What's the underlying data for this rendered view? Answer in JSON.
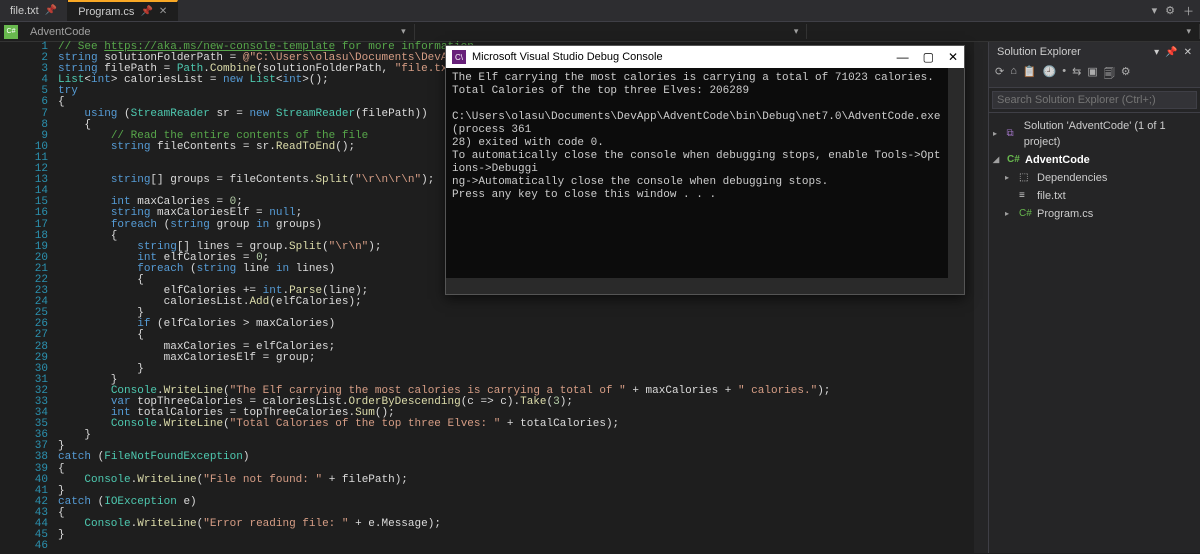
{
  "tabs": {
    "inactive": {
      "label": "file.txt",
      "pin_icon": "📌"
    },
    "active": {
      "label": "Program.cs",
      "pin_icon": "📌",
      "close_icon": "✕"
    },
    "right_icons": {
      "dropdown": "▾",
      "gear": "⚙",
      "add": "＋"
    }
  },
  "breadcrumb": {
    "project_icon": "C#",
    "project": "AdventCode",
    "chev": "▾"
  },
  "code_lines": [
    {
      "n": 1,
      "seg": [
        {
          "c": "cm",
          "t": "// See "
        },
        {
          "c": "url",
          "t": "https://aka.ms/new-console-template"
        },
        {
          "c": "cm",
          "t": " for more information"
        }
      ]
    },
    {
      "n": 2,
      "seg": [
        {
          "c": "kw",
          "t": "string"
        },
        {
          "c": "punct",
          "t": " solutionFolderPath = "
        },
        {
          "c": "str",
          "t": "@\"C:\\Users\\olasu\\Documents\\DevApp\\AdventCode\""
        },
        {
          "c": "punct",
          "t": ";"
        }
      ]
    },
    {
      "n": 3,
      "seg": [
        {
          "c": "kw",
          "t": "string"
        },
        {
          "c": "punct",
          "t": " filePath = "
        },
        {
          "c": "type",
          "t": "Path"
        },
        {
          "c": "punct",
          "t": "."
        },
        {
          "c": "mtd",
          "t": "Combine"
        },
        {
          "c": "punct",
          "t": "(solutionFolderPath, "
        },
        {
          "c": "str",
          "t": "\"file.txt\""
        },
        {
          "c": "punct",
          "t": ");"
        }
      ]
    },
    {
      "n": 4,
      "seg": [
        {
          "c": "type",
          "t": "List"
        },
        {
          "c": "punct",
          "t": "<"
        },
        {
          "c": "kw",
          "t": "int"
        },
        {
          "c": "punct",
          "t": "> caloriesList = "
        },
        {
          "c": "kw",
          "t": "new"
        },
        {
          "c": "punct",
          "t": " "
        },
        {
          "c": "type",
          "t": "List"
        },
        {
          "c": "punct",
          "t": "<"
        },
        {
          "c": "kw",
          "t": "int"
        },
        {
          "c": "punct",
          "t": ">();"
        }
      ]
    },
    {
      "n": 5,
      "seg": [
        {
          "c": "kw",
          "t": "try"
        }
      ]
    },
    {
      "n": 6,
      "seg": [
        {
          "c": "punct",
          "t": "{"
        }
      ]
    },
    {
      "n": 7,
      "seg": [
        {
          "c": "punct",
          "t": "    "
        },
        {
          "c": "kw",
          "t": "using"
        },
        {
          "c": "punct",
          "t": " ("
        },
        {
          "c": "type",
          "t": "StreamReader"
        },
        {
          "c": "punct",
          "t": " sr = "
        },
        {
          "c": "kw",
          "t": "new"
        },
        {
          "c": "punct",
          "t": " "
        },
        {
          "c": "type",
          "t": "StreamReader"
        },
        {
          "c": "punct",
          "t": "(filePath))"
        }
      ]
    },
    {
      "n": 8,
      "seg": [
        {
          "c": "punct",
          "t": "    {"
        }
      ]
    },
    {
      "n": 9,
      "seg": [
        {
          "c": "punct",
          "t": "        "
        },
        {
          "c": "cm",
          "t": "// Read the entire contents of the file"
        }
      ]
    },
    {
      "n": 10,
      "seg": [
        {
          "c": "punct",
          "t": "        "
        },
        {
          "c": "kw",
          "t": "string"
        },
        {
          "c": "punct",
          "t": " fileContents = sr."
        },
        {
          "c": "mtd",
          "t": "ReadToEnd"
        },
        {
          "c": "punct",
          "t": "();"
        }
      ]
    },
    {
      "n": 11,
      "seg": [
        {
          "c": "punct",
          "t": ""
        }
      ]
    },
    {
      "n": 12,
      "seg": [
        {
          "c": "punct",
          "t": ""
        }
      ]
    },
    {
      "n": 13,
      "seg": [
        {
          "c": "punct",
          "t": "        "
        },
        {
          "c": "kw",
          "t": "string"
        },
        {
          "c": "punct",
          "t": "[] groups = fileContents."
        },
        {
          "c": "mtd",
          "t": "Split"
        },
        {
          "c": "punct",
          "t": "("
        },
        {
          "c": "str",
          "t": "\"\\r\\n\\r\\n\""
        },
        {
          "c": "punct",
          "t": ");"
        }
      ]
    },
    {
      "n": 14,
      "seg": [
        {
          "c": "punct",
          "t": ""
        }
      ]
    },
    {
      "n": 15,
      "seg": [
        {
          "c": "punct",
          "t": "        "
        },
        {
          "c": "kw",
          "t": "int"
        },
        {
          "c": "punct",
          "t": " maxCalories = "
        },
        {
          "c": "num",
          "t": "0"
        },
        {
          "c": "punct",
          "t": ";"
        }
      ]
    },
    {
      "n": 16,
      "seg": [
        {
          "c": "punct",
          "t": "        "
        },
        {
          "c": "kw",
          "t": "string"
        },
        {
          "c": "punct",
          "t": " maxCaloriesElf = "
        },
        {
          "c": "kw",
          "t": "null"
        },
        {
          "c": "punct",
          "t": ";"
        }
      ]
    },
    {
      "n": 17,
      "seg": [
        {
          "c": "punct",
          "t": "        "
        },
        {
          "c": "kw",
          "t": "foreach"
        },
        {
          "c": "punct",
          "t": " ("
        },
        {
          "c": "kw",
          "t": "string"
        },
        {
          "c": "punct",
          "t": " group "
        },
        {
          "c": "kw",
          "t": "in"
        },
        {
          "c": "punct",
          "t": " groups)"
        }
      ]
    },
    {
      "n": 18,
      "seg": [
        {
          "c": "punct",
          "t": "        {"
        }
      ]
    },
    {
      "n": 19,
      "seg": [
        {
          "c": "punct",
          "t": "            "
        },
        {
          "c": "kw",
          "t": "string"
        },
        {
          "c": "punct",
          "t": "[] lines = group."
        },
        {
          "c": "mtd",
          "t": "Split"
        },
        {
          "c": "punct",
          "t": "("
        },
        {
          "c": "str",
          "t": "\"\\r\\n\""
        },
        {
          "c": "punct",
          "t": ");"
        }
      ]
    },
    {
      "n": 20,
      "seg": [
        {
          "c": "punct",
          "t": "            "
        },
        {
          "c": "kw",
          "t": "int"
        },
        {
          "c": "punct",
          "t": " elfCalories = "
        },
        {
          "c": "num",
          "t": "0"
        },
        {
          "c": "punct",
          "t": ";"
        }
      ]
    },
    {
      "n": 21,
      "seg": [
        {
          "c": "punct",
          "t": "            "
        },
        {
          "c": "kw",
          "t": "foreach"
        },
        {
          "c": "punct",
          "t": " ("
        },
        {
          "c": "kw",
          "t": "string"
        },
        {
          "c": "punct",
          "t": " line "
        },
        {
          "c": "kw",
          "t": "in"
        },
        {
          "c": "punct",
          "t": " lines)"
        }
      ]
    },
    {
      "n": 22,
      "seg": [
        {
          "c": "punct",
          "t": "            {"
        }
      ]
    },
    {
      "n": 23,
      "seg": [
        {
          "c": "punct",
          "t": "                elfCalories += "
        },
        {
          "c": "kw",
          "t": "int"
        },
        {
          "c": "punct",
          "t": "."
        },
        {
          "c": "mtd",
          "t": "Parse"
        },
        {
          "c": "punct",
          "t": "(line);"
        }
      ]
    },
    {
      "n": 24,
      "seg": [
        {
          "c": "punct",
          "t": "                caloriesList."
        },
        {
          "c": "mtd",
          "t": "Add"
        },
        {
          "c": "punct",
          "t": "(elfCalories);"
        }
      ]
    },
    {
      "n": 25,
      "seg": [
        {
          "c": "punct",
          "t": "            }"
        }
      ]
    },
    {
      "n": 26,
      "seg": [
        {
          "c": "punct",
          "t": "            "
        },
        {
          "c": "kw",
          "t": "if"
        },
        {
          "c": "punct",
          "t": " (elfCalories > maxCalories)"
        }
      ]
    },
    {
      "n": 27,
      "seg": [
        {
          "c": "punct",
          "t": "            {"
        }
      ]
    },
    {
      "n": 28,
      "seg": [
        {
          "c": "punct",
          "t": "                maxCalories = elfCalories;"
        }
      ]
    },
    {
      "n": 29,
      "seg": [
        {
          "c": "punct",
          "t": "                maxCaloriesElf = group;"
        }
      ]
    },
    {
      "n": 30,
      "seg": [
        {
          "c": "punct",
          "t": "            }"
        }
      ]
    },
    {
      "n": 31,
      "seg": [
        {
          "c": "punct",
          "t": "        }"
        }
      ]
    },
    {
      "n": 32,
      "seg": [
        {
          "c": "punct",
          "t": "        "
        },
        {
          "c": "type",
          "t": "Console"
        },
        {
          "c": "punct",
          "t": "."
        },
        {
          "c": "mtd",
          "t": "WriteLine"
        },
        {
          "c": "punct",
          "t": "("
        },
        {
          "c": "str",
          "t": "\"The Elf carrying the most calories is carrying a total of \""
        },
        {
          "c": "punct",
          "t": " + maxCalories + "
        },
        {
          "c": "str",
          "t": "\" calories.\""
        },
        {
          "c": "punct",
          "t": ");"
        }
      ]
    },
    {
      "n": 33,
      "seg": [
        {
          "c": "punct",
          "t": "        "
        },
        {
          "c": "kw",
          "t": "var"
        },
        {
          "c": "punct",
          "t": " topThreeCalories = caloriesList."
        },
        {
          "c": "mtd",
          "t": "OrderByDescending"
        },
        {
          "c": "punct",
          "t": "(c => c)."
        },
        {
          "c": "mtd",
          "t": "Take"
        },
        {
          "c": "punct",
          "t": "("
        },
        {
          "c": "num",
          "t": "3"
        },
        {
          "c": "punct",
          "t": ");"
        }
      ]
    },
    {
      "n": 34,
      "seg": [
        {
          "c": "punct",
          "t": "        "
        },
        {
          "c": "kw",
          "t": "int"
        },
        {
          "c": "punct",
          "t": " totalCalories = topThreeCalories."
        },
        {
          "c": "mtd",
          "t": "Sum"
        },
        {
          "c": "punct",
          "t": "();"
        }
      ]
    },
    {
      "n": 35,
      "seg": [
        {
          "c": "punct",
          "t": "        "
        },
        {
          "c": "type",
          "t": "Console"
        },
        {
          "c": "punct",
          "t": "."
        },
        {
          "c": "mtd",
          "t": "WriteLine"
        },
        {
          "c": "punct",
          "t": "("
        },
        {
          "c": "str",
          "t": "\"Total Calories of the top three Elves: \""
        },
        {
          "c": "punct",
          "t": " + totalCalories);"
        }
      ]
    },
    {
      "n": 36,
      "seg": [
        {
          "c": "punct",
          "t": "    }"
        }
      ]
    },
    {
      "n": 37,
      "seg": [
        {
          "c": "punct",
          "t": "}"
        }
      ]
    },
    {
      "n": 38,
      "seg": [
        {
          "c": "kw",
          "t": "catch"
        },
        {
          "c": "punct",
          "t": " ("
        },
        {
          "c": "type",
          "t": "FileNotFoundException"
        },
        {
          "c": "punct",
          "t": ")"
        }
      ]
    },
    {
      "n": 39,
      "seg": [
        {
          "c": "punct",
          "t": "{"
        }
      ]
    },
    {
      "n": 40,
      "seg": [
        {
          "c": "punct",
          "t": "    "
        },
        {
          "c": "type",
          "t": "Console"
        },
        {
          "c": "punct",
          "t": "."
        },
        {
          "c": "mtd",
          "t": "WriteLine"
        },
        {
          "c": "punct",
          "t": "("
        },
        {
          "c": "str",
          "t": "\"File not found: \""
        },
        {
          "c": "punct",
          "t": " + filePath);"
        }
      ]
    },
    {
      "n": 41,
      "seg": [
        {
          "c": "punct",
          "t": "}"
        }
      ]
    },
    {
      "n": 42,
      "seg": [
        {
          "c": "kw",
          "t": "catch"
        },
        {
          "c": "punct",
          "t": " ("
        },
        {
          "c": "type",
          "t": "IOException"
        },
        {
          "c": "punct",
          "t": " e)"
        }
      ]
    },
    {
      "n": 43,
      "seg": [
        {
          "c": "punct",
          "t": "{"
        }
      ]
    },
    {
      "n": 44,
      "seg": [
        {
          "c": "punct",
          "t": "    "
        },
        {
          "c": "type",
          "t": "Console"
        },
        {
          "c": "punct",
          "t": "."
        },
        {
          "c": "mtd",
          "t": "WriteLine"
        },
        {
          "c": "punct",
          "t": "("
        },
        {
          "c": "str",
          "t": "\"Error reading file: \""
        },
        {
          "c": "punct",
          "t": " + e.Message);"
        }
      ]
    },
    {
      "n": 45,
      "seg": [
        {
          "c": "punct",
          "t": "}"
        }
      ]
    },
    {
      "n": 46,
      "seg": [
        {
          "c": "punct",
          "t": ""
        }
      ]
    }
  ],
  "debug_console": {
    "title": "Microsoft Visual Studio Debug Console",
    "icon_text": "C\\",
    "win_min": "—",
    "win_max": "▢",
    "win_close": "✕",
    "body": "The Elf carrying the most calories is carrying a total of 71023 calories.\nTotal Calories of the top three Elves: 206289\n\nC:\\Users\\olasu\\Documents\\DevApp\\AdventCode\\bin\\Debug\\net7.0\\AdventCode.exe (process 361\n28) exited with code 0.\nTo automatically close the console when debugging stops, enable Tools->Options->Debuggi\nng->Automatically close the console when debugging stops.\nPress any key to close this window . . ."
  },
  "solution_explorer": {
    "title": "Solution Explorer",
    "title_icons": {
      "dropdown": "▾",
      "pin": "📌",
      "close": "✕"
    },
    "toolbar_icons": [
      "⟳",
      "⌂",
      "📋",
      "🕘",
      "•",
      "⇆",
      "▣",
      "🗐",
      "⚙"
    ],
    "search_placeholder": "Search Solution Explorer (Ctrl+;)",
    "search_icon": "🔍",
    "tree": [
      {
        "level": 0,
        "expand": "▸",
        "icon": "sln",
        "label": "Solution 'AdventCode' (1 of 1 project)"
      },
      {
        "level": 0,
        "expand": "◢",
        "icon": "csproj",
        "label": "AdventCode",
        "bold": true
      },
      {
        "level": 1,
        "expand": "▸",
        "icon": "dep",
        "label": "Dependencies"
      },
      {
        "level": 1,
        "expand": "",
        "icon": "txt",
        "label": "file.txt"
      },
      {
        "level": 1,
        "expand": "▸",
        "icon": "cs",
        "label": "Program.cs"
      }
    ]
  }
}
